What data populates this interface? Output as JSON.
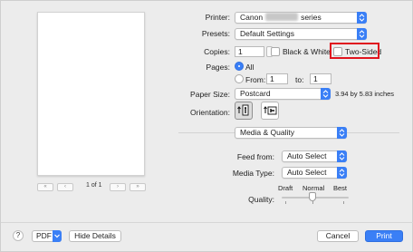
{
  "preview": {
    "page_indicator": "1 of 1",
    "first_label": "«",
    "prev_label": "‹",
    "next_label": "›",
    "last_label": "»"
  },
  "printer": {
    "label": "Printer:",
    "value_prefix": "Canon",
    "value_suffix": "series"
  },
  "presets": {
    "label": "Presets:",
    "value": "Default Settings"
  },
  "copies": {
    "label": "Copies:",
    "value": "1",
    "bw_label": "Black & White",
    "two_sided_label": "Two-Sided"
  },
  "pages": {
    "label": "Pages:",
    "all_label": "All",
    "from_label": "From:",
    "from_value": "1",
    "to_label": "to:",
    "to_value": "1"
  },
  "paper_size": {
    "label": "Paper Size:",
    "value": "Postcard",
    "dimensions": "3.94 by 5.83 inches"
  },
  "orientation": {
    "label": "Orientation:"
  },
  "section": {
    "value": "Media & Quality"
  },
  "feed_from": {
    "label": "Feed from:",
    "value": "Auto Select"
  },
  "media_type": {
    "label": "Media Type:",
    "value": "Auto Select"
  },
  "quality": {
    "label": "Quality:",
    "draft": "Draft",
    "normal": "Normal",
    "best": "Best",
    "level": 0.5
  },
  "footer": {
    "help": "?",
    "pdf": "PDF",
    "hide_details": "Hide Details",
    "cancel": "Cancel",
    "print": "Print"
  },
  "colors": {
    "accent": "#3a7ff6",
    "highlight_box": "#e0141e"
  }
}
